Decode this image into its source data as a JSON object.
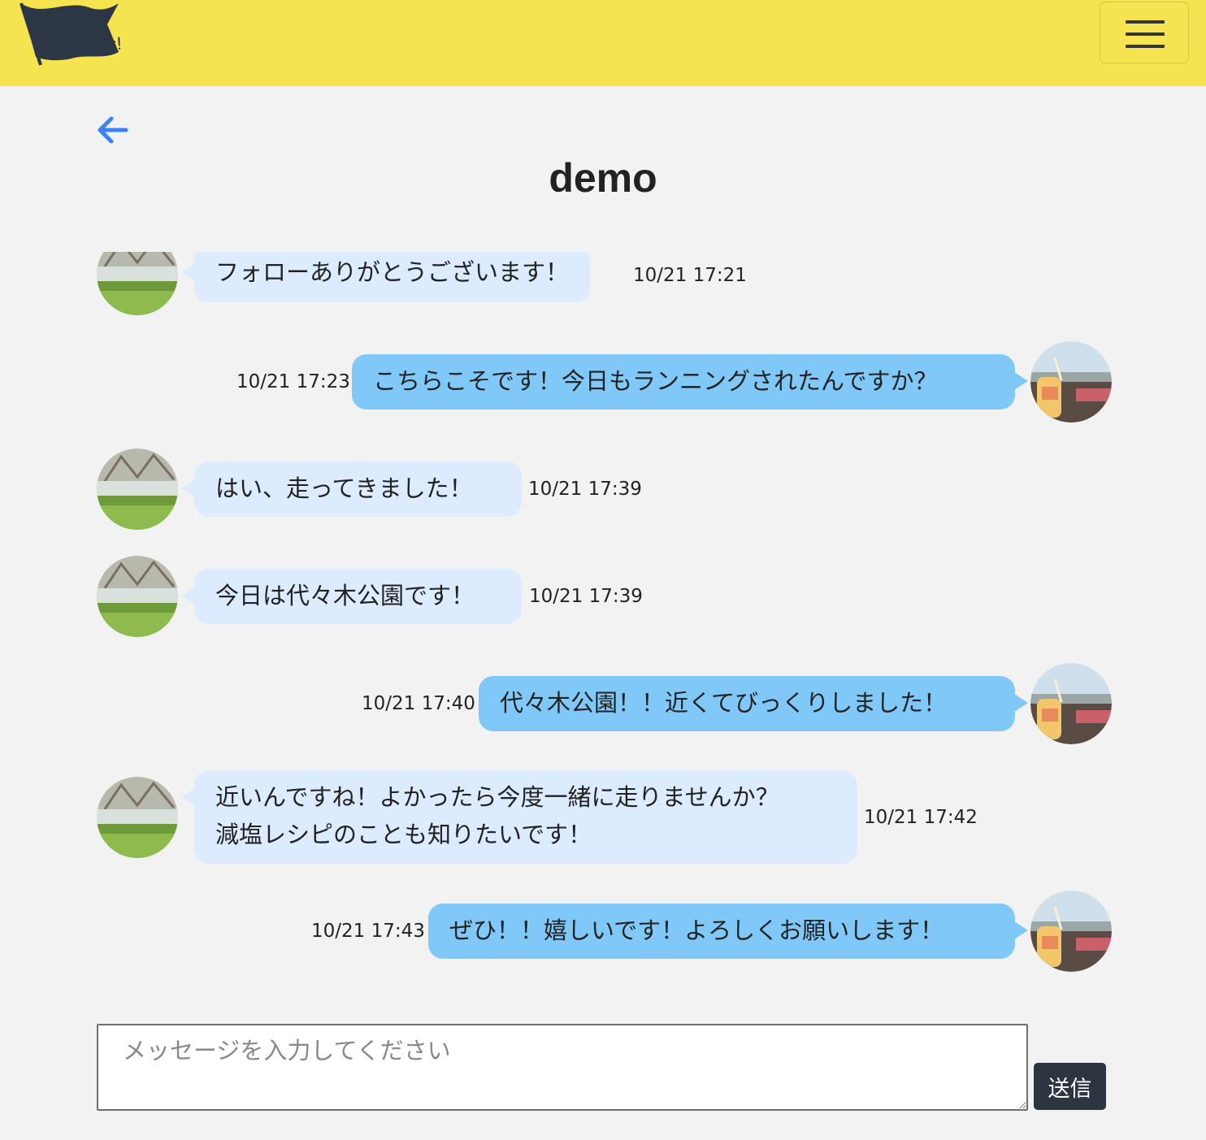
{
  "navbar": {
    "logo_text": "Cheers!",
    "logo_icon": "flag-icon",
    "menu_icon": "hamburger-menu-icon",
    "color": "#f5e34f"
  },
  "back": {
    "icon": "arrow-left-icon",
    "color": "#3b82f6"
  },
  "page": {
    "title": "demo"
  },
  "messages": [
    {
      "side": "left",
      "text": "フォローありがとうございます！",
      "time": "10/21 17:21"
    },
    {
      "side": "right",
      "text": "こちらこそです！今日もランニングされたんですか？",
      "time": "10/21 17:23"
    },
    {
      "side": "left",
      "text": "はい、走ってきました！",
      "time": "10/21 17:39"
    },
    {
      "side": "left",
      "text": "今日は代々木公園です！",
      "time": "10/21 17:39"
    },
    {
      "side": "right",
      "text": "代々木公園！！近くてびっくりしました！",
      "time": "10/21 17:40"
    },
    {
      "side": "left",
      "text_lines": [
        "近いんですね！よかったら今度一緒に走りませんか？",
        "減塩レシピのことも知りたいです！"
      ],
      "time": "10/21 17:42"
    },
    {
      "side": "right",
      "text": "ぜひ！！嬉しいです！よろしくお願いします！",
      "time": "10/21 17:43"
    }
  ],
  "composer": {
    "placeholder": "メッセージを入力してください",
    "value": "",
    "send_label": "送信"
  },
  "colors": {
    "incoming_bubble": "#dcebfd",
    "outgoing_bubble": "#80c8f8",
    "send_button": "#2d3541"
  }
}
